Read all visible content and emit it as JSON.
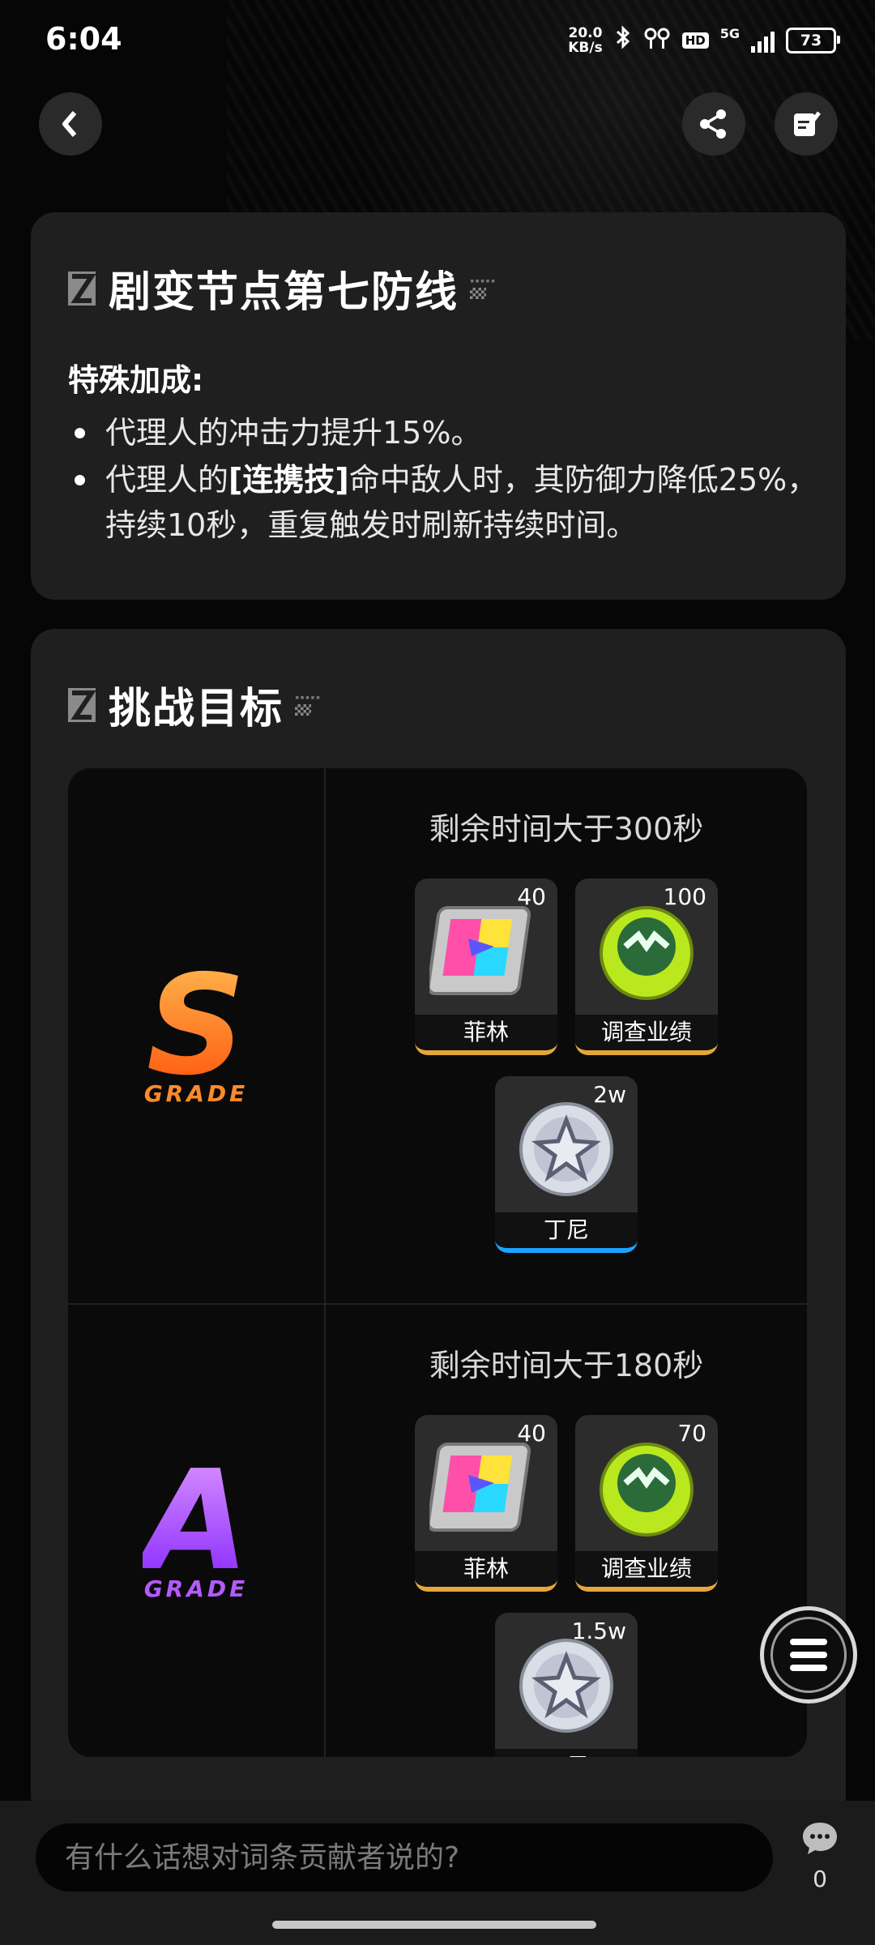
{
  "status_bar": {
    "time": "6:04",
    "net_speed_value": "20.0",
    "net_speed_unit": "KB/s",
    "hd": "HD",
    "network": "5G",
    "battery": "73"
  },
  "nav": {
    "back_icon": "chevron-left-icon",
    "share_icon": "share-icon",
    "edit_icon": "edit-note-icon"
  },
  "bonus_card": {
    "title": "剧变节点第七防线",
    "label": "特殊加成:",
    "bullet1": "代理人的冲击力提升15%。",
    "bullet2_prefix": "代理人的",
    "bullet2_highlight": "[连携技]",
    "bullet2_suffix": "命中敌人时，其防御力降低25%，持续10秒，重复触发时刷新持续时间。"
  },
  "challenge_card": {
    "title": "挑战目标",
    "grades": [
      {
        "letter": "S",
        "word": "GRADE",
        "condition": "剩余时间大于300秒",
        "rewards": [
          {
            "name": "菲林",
            "qty": "40"
          },
          {
            "name": "调查业绩",
            "qty": "100"
          },
          {
            "name": "丁尼",
            "qty": "2w"
          }
        ]
      },
      {
        "letter": "A",
        "word": "GRADE",
        "condition": "剩余时间大于180秒",
        "rewards": [
          {
            "name": "菲林",
            "qty": "40"
          },
          {
            "name": "调查业绩",
            "qty": "70"
          },
          {
            "name": "丁尼",
            "qty": "1.5w"
          }
        ]
      }
    ]
  },
  "colors": {
    "s_grade": "#ff6a1a",
    "a_grade": "#a23cff",
    "gold_rarity": "#e5a73a",
    "blue_rarity": "#1aa3ff"
  },
  "bottom": {
    "comment_placeholder": "有什么话想对词条贡献者说的?",
    "comment_count": "0"
  }
}
